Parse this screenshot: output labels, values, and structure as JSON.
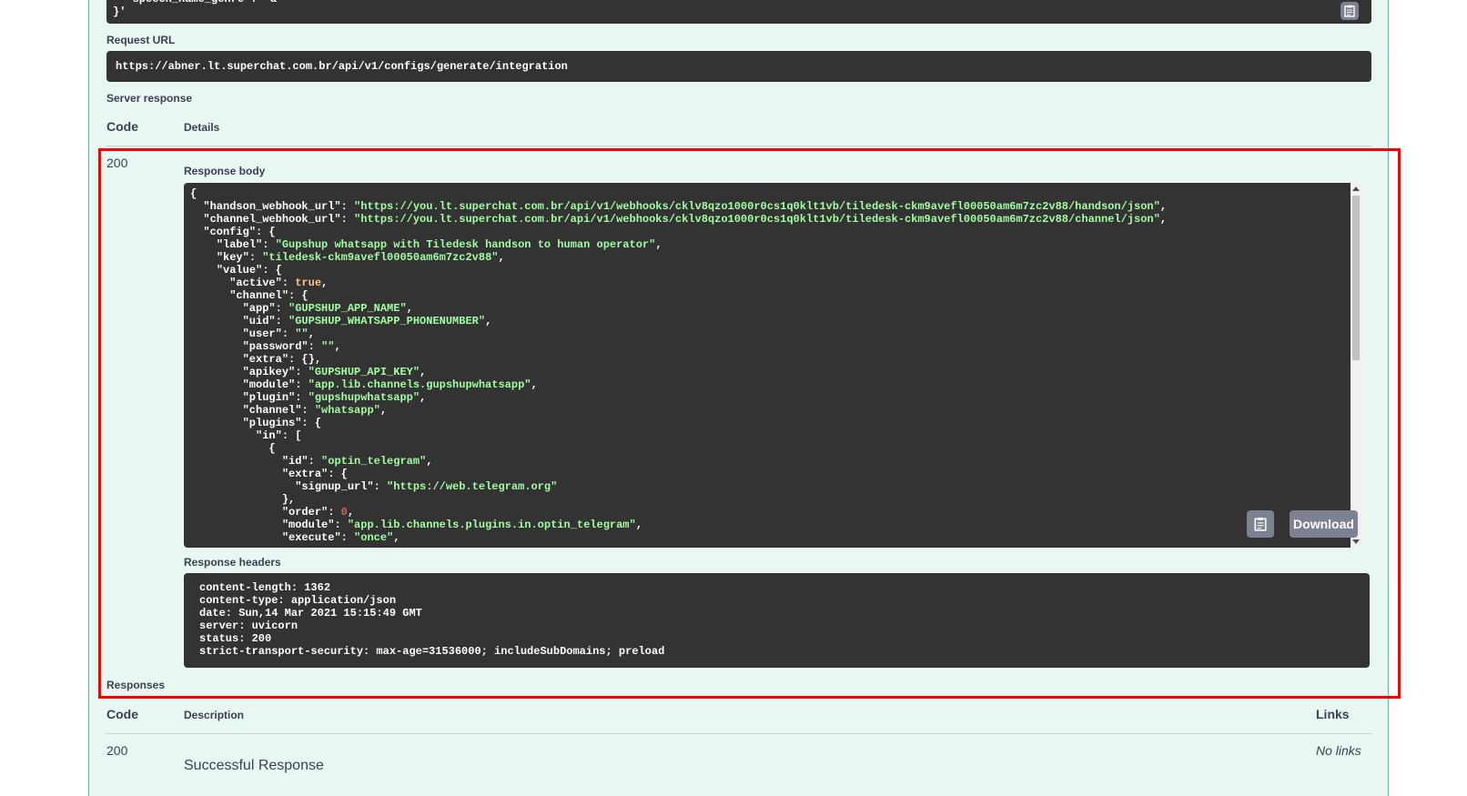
{
  "curl_tail": {
    "lines": [
      "  \"speech_name_genre\": \"a\"",
      "}'"
    ]
  },
  "request_url": {
    "label": "Request URL",
    "value": "https://abner.lt.superchat.com.br/api/v1/configs/generate/integration"
  },
  "server_response": {
    "label": "Server response",
    "col_code": "Code",
    "col_details": "Details",
    "code": "200",
    "response_body_label": "Response body",
    "response_headers_label": "Response headers",
    "download_label": "Download",
    "headers": [
      "content-length: 1362",
      "content-type: application/json",
      "date: Sun,14 Mar 2021 15:15:49 GMT",
      "server: uvicorn",
      "status: 200",
      "strict-transport-security: max-age=31536000; includeSubDomains; preload"
    ]
  },
  "response_body": [
    [
      {
        "t": "p",
        "v": "{"
      }
    ],
    [
      {
        "t": "p",
        "v": "  "
      },
      {
        "t": "k",
        "v": "\"handson_webhook_url\""
      },
      {
        "t": "p",
        "v": ": "
      },
      {
        "t": "s",
        "v": "\"https://you.lt.superchat.com.br/api/v1/webhooks/cklv8qzo1000r0cs1q0klt1vb/tiledesk-ckm9avefl00050am6m7zc2v88/handson/json\""
      },
      {
        "t": "p",
        "v": ","
      }
    ],
    [
      {
        "t": "p",
        "v": "  "
      },
      {
        "t": "k",
        "v": "\"channel_webhook_url\""
      },
      {
        "t": "p",
        "v": ": "
      },
      {
        "t": "s",
        "v": "\"https://you.lt.superchat.com.br/api/v1/webhooks/cklv8qzo1000r0cs1q0klt1vb/tiledesk-ckm9avefl00050am6m7zc2v88/channel/json\""
      },
      {
        "t": "p",
        "v": ","
      }
    ],
    [
      {
        "t": "p",
        "v": "  "
      },
      {
        "t": "k",
        "v": "\"config\""
      },
      {
        "t": "p",
        "v": ": {"
      }
    ],
    [
      {
        "t": "p",
        "v": "    "
      },
      {
        "t": "k",
        "v": "\"label\""
      },
      {
        "t": "p",
        "v": ": "
      },
      {
        "t": "s",
        "v": "\"Gupshup whatsapp with Tiledesk handson to human operator\""
      },
      {
        "t": "p",
        "v": ","
      }
    ],
    [
      {
        "t": "p",
        "v": "    "
      },
      {
        "t": "k",
        "v": "\"key\""
      },
      {
        "t": "p",
        "v": ": "
      },
      {
        "t": "s",
        "v": "\"tiledesk-ckm9avefl00050am6m7zc2v88\""
      },
      {
        "t": "p",
        "v": ","
      }
    ],
    [
      {
        "t": "p",
        "v": "    "
      },
      {
        "t": "k",
        "v": "\"value\""
      },
      {
        "t": "p",
        "v": ": {"
      }
    ],
    [
      {
        "t": "p",
        "v": "      "
      },
      {
        "t": "k",
        "v": "\"active\""
      },
      {
        "t": "p",
        "v": ": "
      },
      {
        "t": "b",
        "v": "true"
      },
      {
        "t": "p",
        "v": ","
      }
    ],
    [
      {
        "t": "p",
        "v": "      "
      },
      {
        "t": "k",
        "v": "\"channel\""
      },
      {
        "t": "p",
        "v": ": {"
      }
    ],
    [
      {
        "t": "p",
        "v": "        "
      },
      {
        "t": "k",
        "v": "\"app\""
      },
      {
        "t": "p",
        "v": ": "
      },
      {
        "t": "s",
        "v": "\"GUPSHUP_APP_NAME\""
      },
      {
        "t": "p",
        "v": ","
      }
    ],
    [
      {
        "t": "p",
        "v": "        "
      },
      {
        "t": "k",
        "v": "\"uid\""
      },
      {
        "t": "p",
        "v": ": "
      },
      {
        "t": "s",
        "v": "\"GUPSHUP_WHATSAPP_PHONENUMBER\""
      },
      {
        "t": "p",
        "v": ","
      }
    ],
    [
      {
        "t": "p",
        "v": "        "
      },
      {
        "t": "k",
        "v": "\"user\""
      },
      {
        "t": "p",
        "v": ": "
      },
      {
        "t": "s",
        "v": "\"\""
      },
      {
        "t": "p",
        "v": ","
      }
    ],
    [
      {
        "t": "p",
        "v": "        "
      },
      {
        "t": "k",
        "v": "\"password\""
      },
      {
        "t": "p",
        "v": ": "
      },
      {
        "t": "s",
        "v": "\"\""
      },
      {
        "t": "p",
        "v": ","
      }
    ],
    [
      {
        "t": "p",
        "v": "        "
      },
      {
        "t": "k",
        "v": "\"extra\""
      },
      {
        "t": "p",
        "v": ": {},"
      }
    ],
    [
      {
        "t": "p",
        "v": "        "
      },
      {
        "t": "k",
        "v": "\"apikey\""
      },
      {
        "t": "p",
        "v": ": "
      },
      {
        "t": "s",
        "v": "\"GUPSHUP_API_KEY\""
      },
      {
        "t": "p",
        "v": ","
      }
    ],
    [
      {
        "t": "p",
        "v": "        "
      },
      {
        "t": "k",
        "v": "\"module\""
      },
      {
        "t": "p",
        "v": ": "
      },
      {
        "t": "s",
        "v": "\"app.lib.channels.gupshupwhatsapp\""
      },
      {
        "t": "p",
        "v": ","
      }
    ],
    [
      {
        "t": "p",
        "v": "        "
      },
      {
        "t": "k",
        "v": "\"plugin\""
      },
      {
        "t": "p",
        "v": ": "
      },
      {
        "t": "s",
        "v": "\"gupshupwhatsapp\""
      },
      {
        "t": "p",
        "v": ","
      }
    ],
    [
      {
        "t": "p",
        "v": "        "
      },
      {
        "t": "k",
        "v": "\"channel\""
      },
      {
        "t": "p",
        "v": ": "
      },
      {
        "t": "s",
        "v": "\"whatsapp\""
      },
      {
        "t": "p",
        "v": ","
      }
    ],
    [
      {
        "t": "p",
        "v": "        "
      },
      {
        "t": "k",
        "v": "\"plugins\""
      },
      {
        "t": "p",
        "v": ": {"
      }
    ],
    [
      {
        "t": "p",
        "v": "          "
      },
      {
        "t": "k",
        "v": "\"in\""
      },
      {
        "t": "p",
        "v": ": ["
      }
    ],
    [
      {
        "t": "p",
        "v": "            {"
      }
    ],
    [
      {
        "t": "p",
        "v": "              "
      },
      {
        "t": "k",
        "v": "\"id\""
      },
      {
        "t": "p",
        "v": ": "
      },
      {
        "t": "s",
        "v": "\"optin_telegram\""
      },
      {
        "t": "p",
        "v": ","
      }
    ],
    [
      {
        "t": "p",
        "v": "              "
      },
      {
        "t": "k",
        "v": "\"extra\""
      },
      {
        "t": "p",
        "v": ": {"
      }
    ],
    [
      {
        "t": "p",
        "v": "                "
      },
      {
        "t": "k",
        "v": "\"signup_url\""
      },
      {
        "t": "p",
        "v": ": "
      },
      {
        "t": "s",
        "v": "\"https://web.telegram.org\""
      }
    ],
    [
      {
        "t": "p",
        "v": "              },"
      }
    ],
    [
      {
        "t": "p",
        "v": "              "
      },
      {
        "t": "k",
        "v": "\"order\""
      },
      {
        "t": "p",
        "v": ": "
      },
      {
        "t": "n",
        "v": "0"
      },
      {
        "t": "p",
        "v": ","
      }
    ],
    [
      {
        "t": "p",
        "v": "              "
      },
      {
        "t": "k",
        "v": "\"module\""
      },
      {
        "t": "p",
        "v": ": "
      },
      {
        "t": "s",
        "v": "\"app.lib.channels.plugins.in.optin_telegram\""
      },
      {
        "t": "p",
        "v": ","
      }
    ],
    [
      {
        "t": "p",
        "v": "              "
      },
      {
        "t": "k",
        "v": "\"execute\""
      },
      {
        "t": "p",
        "v": ": "
      },
      {
        "t": "s",
        "v": "\"once\""
      },
      {
        "t": "p",
        "v": ","
      }
    ]
  ],
  "responses": {
    "label": "Responses",
    "col_code": "Code",
    "col_description": "Description",
    "col_links": "Links",
    "rows": [
      {
        "code": "200",
        "description": "Successful Response",
        "links": "No links"
      }
    ]
  },
  "icons": {
    "copy": "clipboard-icon"
  },
  "colors": {
    "panel_bg": "#e9f7f2",
    "panel_border": "#49cc90",
    "code_bg": "#333333",
    "string": "#a2fca2",
    "boolean": "#fcc28c",
    "number": "#d36363",
    "highlight": "#ff0000"
  }
}
